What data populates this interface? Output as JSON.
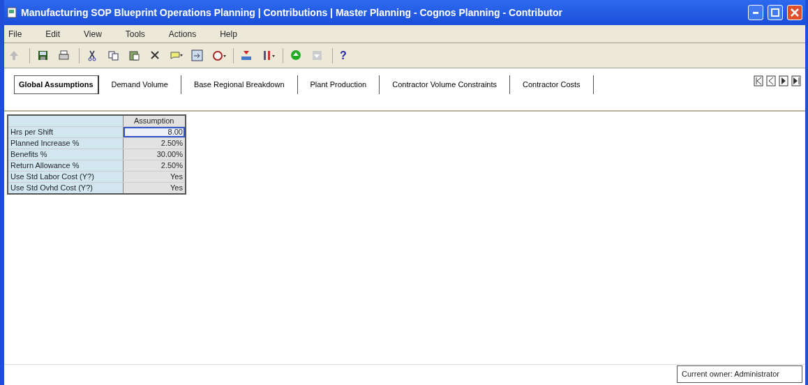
{
  "window": {
    "title": "Manufacturing SOP Blueprint Operations Planning | Contributions | Master Planning - Cognos Planning - Contributor"
  },
  "menu": [
    "File",
    "Edit",
    "View",
    "Tools",
    "Actions",
    "Help"
  ],
  "toolbar": {
    "help_label": "?"
  },
  "tabs": [
    {
      "label": "Global Assumptions",
      "selected": true
    },
    {
      "label": "Demand Volume",
      "selected": false
    },
    {
      "label": "Base Regional Breakdown",
      "selected": false
    },
    {
      "label": "Plant Production",
      "selected": false
    },
    {
      "label": "Contractor Volume Constraints",
      "selected": false
    },
    {
      "label": "Contractor Costs",
      "selected": false
    }
  ],
  "table": {
    "columns": [
      "Assumption"
    ],
    "rows": [
      {
        "label": "Hrs per Shift",
        "value": "8.00",
        "selected": true
      },
      {
        "label": "Planned Increase %",
        "value": "2.50%",
        "selected": false
      },
      {
        "label": "Benefits %",
        "value": "30.00%",
        "selected": false
      },
      {
        "label": "Return Allowance %",
        "value": "2.50%",
        "selected": false
      },
      {
        "label": "Use Std Labor Cost (Y?)",
        "value": "Yes",
        "selected": false
      },
      {
        "label": "Use Std Ovhd Cost (Y?)",
        "value": "Yes",
        "selected": false
      }
    ]
  },
  "status_bar": {
    "owner": "Current owner: Administrator"
  }
}
